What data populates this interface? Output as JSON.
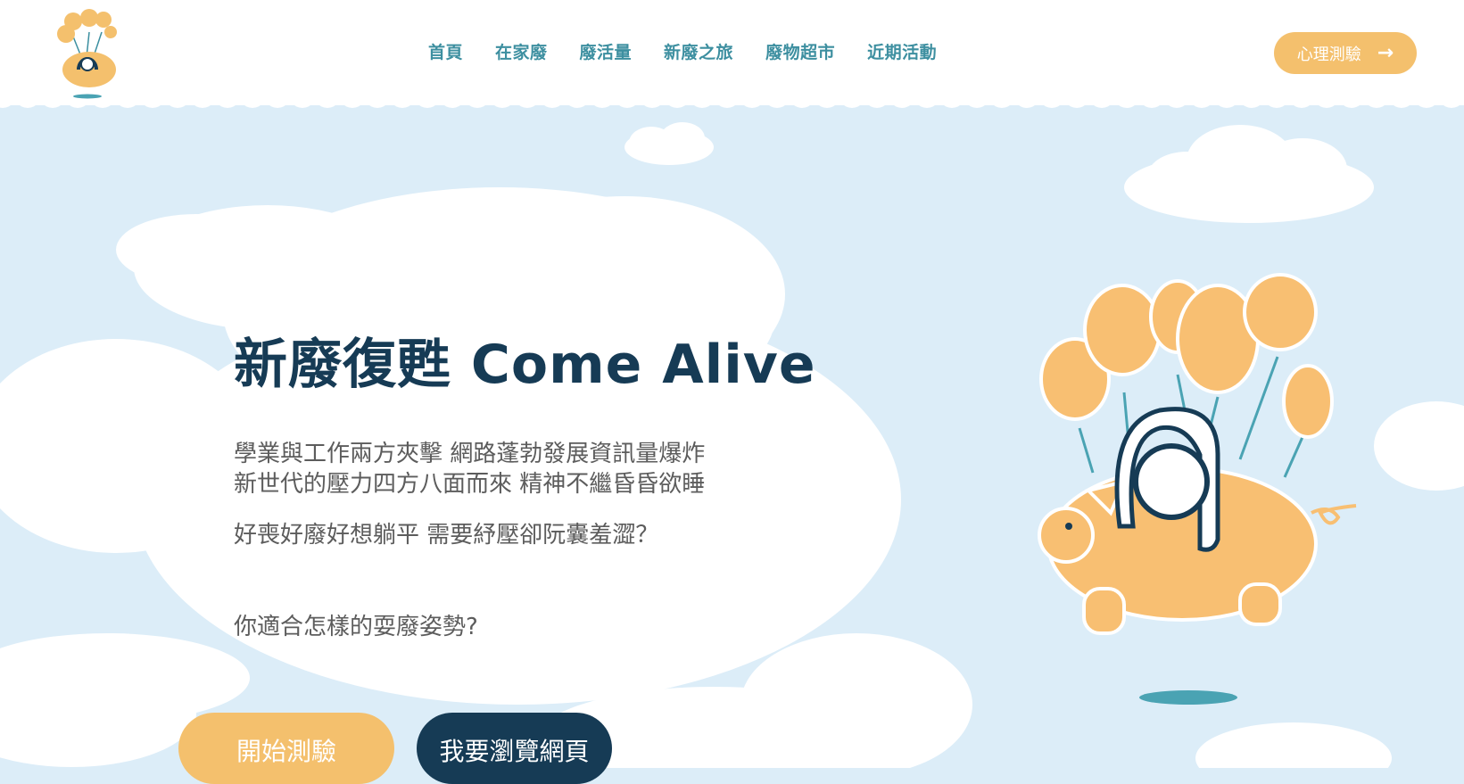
{
  "header": {
    "nav": [
      "首頁",
      "在家廢",
      "廢活量",
      "新廢之旅",
      "廢物超市",
      "近期活動"
    ],
    "quiz_button": "心理測驗",
    "quiz_arrow_icon": "arrow-right-icon"
  },
  "hero": {
    "title": "新廢復甦 Come Alive",
    "line1": "學業與工作兩方夾擊 網路蓬勃發展資訊量爆炸",
    "line2": "新世代的壓力四方八面而來 精神不繼昏昏欲睡",
    "line3": "好喪好廢好想躺平 需要紓壓卻阮囊羞澀？",
    "question": "你適合怎樣的耍廢姿勢?",
    "start_button": "開始測驗",
    "browse_button": "我要瀏覽網頁"
  },
  "colors": {
    "sky": "#dcedf8",
    "accent": "#f4c06d",
    "navy": "#163b55",
    "nav_teal": "#3d8fa0",
    "body_text": "#5c5c5c"
  }
}
